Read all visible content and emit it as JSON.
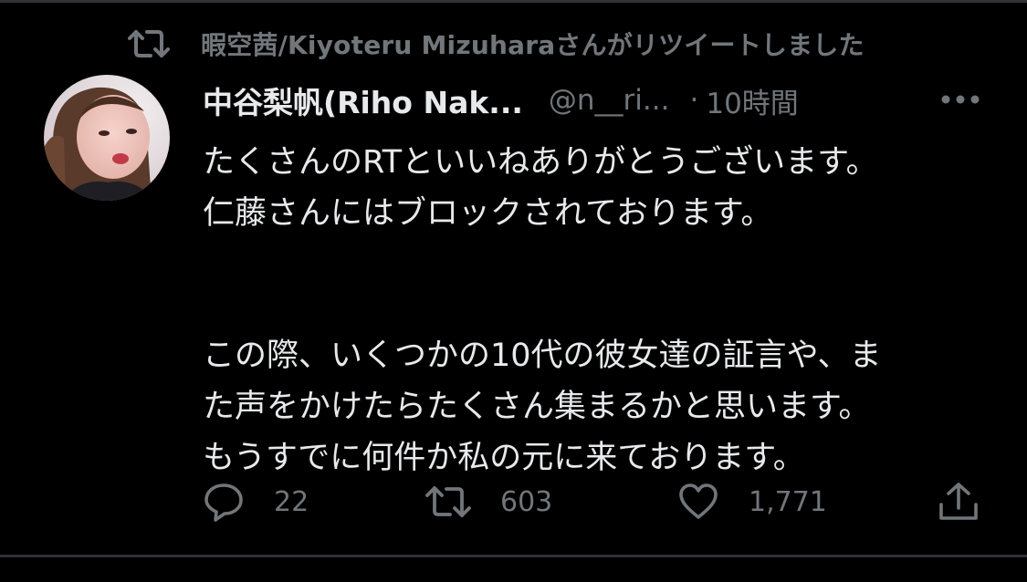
{
  "retweet_header": {
    "text": "暇空茜/Kiyoteru Mizuharaさんがリツイートしました",
    "icon": "retweet-icon"
  },
  "tweet": {
    "author": {
      "display_name": "中谷梨帆(Riho Nak...",
      "handle": "@n__ri...",
      "avatar": "avatar-photo"
    },
    "separator": "·",
    "time": "10時間",
    "more_icon": "more-horizontal-icon",
    "body_lines": [
      "たくさんのRTといいねありがとうございます。",
      "仁藤さんにはブロックされております。",
      "この際、いくつかの10代の彼女達の証言や、ま",
      "た声をかけたらたくさん集まるかと思います。",
      "もうすでに何件か私の元に来ております。"
    ],
    "actions": {
      "reply_count": "22",
      "retweet_count": "603",
      "like_count": "1,771"
    }
  },
  "colors": {
    "background": "#000000",
    "text_primary": "#e7e9ea",
    "text_secondary": "#71767b",
    "divider": "#2f3336"
  }
}
